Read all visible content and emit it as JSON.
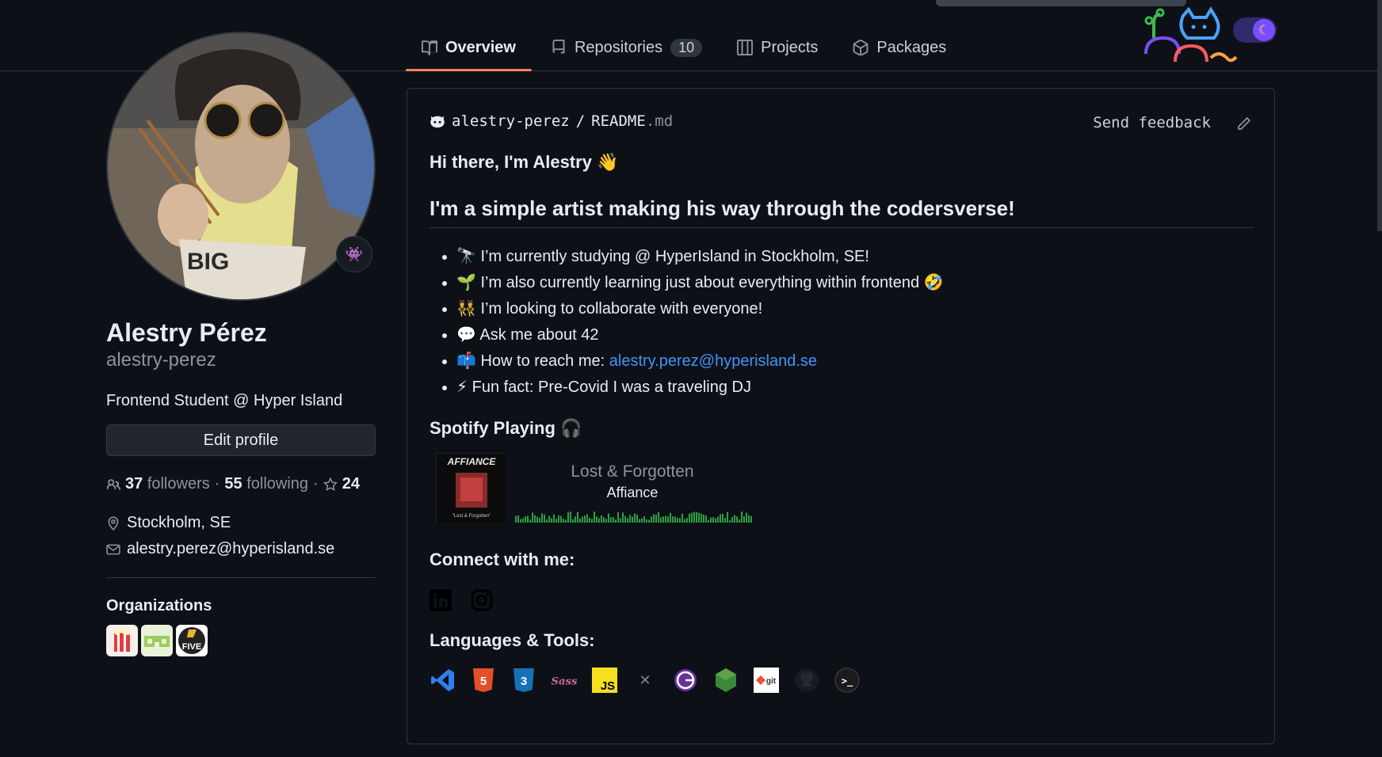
{
  "tabs": [
    {
      "label": "Overview",
      "icon": "book-icon",
      "active": true
    },
    {
      "label": "Repositories",
      "icon": "repo-icon",
      "count": "10"
    },
    {
      "label": "Projects",
      "icon": "project-icon"
    },
    {
      "label": "Packages",
      "icon": "package-icon"
    }
  ],
  "profile": {
    "name": "Alestry Pérez",
    "login": "alestry-perez",
    "bio": "Frontend Student @ Hyper Island",
    "edit_label": "Edit profile",
    "followers_count": "37",
    "followers_label": "followers",
    "following_count": "55",
    "following_label": "following",
    "stars_count": "24",
    "separator": "·",
    "location": "Stockholm, SE",
    "email": "alestry.perez@hyperisland.se",
    "status_emoji": "👾"
  },
  "organizations": {
    "title": "Organizations",
    "items": [
      "org-popcorn",
      "org-pixel",
      "org-five"
    ]
  },
  "readme": {
    "owner": "alestry-perez",
    "slash": "/",
    "file": "README",
    "ext": ".md",
    "feedback_label": "Send feedback",
    "greeting": "Hi there, I'm Alestry 👋",
    "headline": "I'm a simple artist making his way through the codersverse!",
    "bullets": [
      {
        "emoji": "🔭",
        "text": "I’m currently studying @ HyperIsland in Stockholm, SE!"
      },
      {
        "emoji": "🌱",
        "text": "I’m also currently learning just about everything within frontend 🤣"
      },
      {
        "emoji": "👯",
        "text": "I’m looking to collaborate with everyone!"
      },
      {
        "emoji": "💬",
        "text": "Ask me about 42"
      },
      {
        "emoji": "📫",
        "text": "How to reach me: ",
        "link": "alestry.perez@hyperisland.se"
      },
      {
        "emoji": "⚡",
        "text": "Fun fact: Pre-Covid I was a traveling DJ"
      }
    ],
    "spotify_title": "Spotify Playing 🎧",
    "spotify": {
      "song": "Lost & Forgotten",
      "artist": "Affiance",
      "cover_title": "AFFIANCE",
      "cover_caption": "\"Lost & Forgotten\""
    },
    "connect_title": "Connect with me:",
    "social": [
      "linkedin-icon",
      "instagram-icon"
    ],
    "tools_title": "Languages & Tools:",
    "tools": [
      {
        "name": "vscode-icon",
        "label": "",
        "color": "#2f80ed"
      },
      {
        "name": "html5-icon",
        "label": "5",
        "color": "#e34f26"
      },
      {
        "name": "css3-icon",
        "label": "3",
        "color": "#1572b6"
      },
      {
        "name": "sass-icon",
        "label": "Sass",
        "color": "#cd6799"
      },
      {
        "name": "javascript-icon",
        "label": "JS",
        "color": "#f7df1e"
      },
      {
        "name": "express-icon",
        "label": "✕",
        "color": "#888888"
      },
      {
        "name": "gatsby-icon",
        "label": "G",
        "color": "#663399"
      },
      {
        "name": "nodejs-icon",
        "label": "",
        "color": "#3c873a"
      },
      {
        "name": "git-icon",
        "label": "git",
        "color": "#f05032"
      },
      {
        "name": "github-icon",
        "label": "",
        "color": "#24292e"
      },
      {
        "name": "terminal-icon",
        "label": ">_",
        "color": "#2b2b2b"
      }
    ]
  }
}
